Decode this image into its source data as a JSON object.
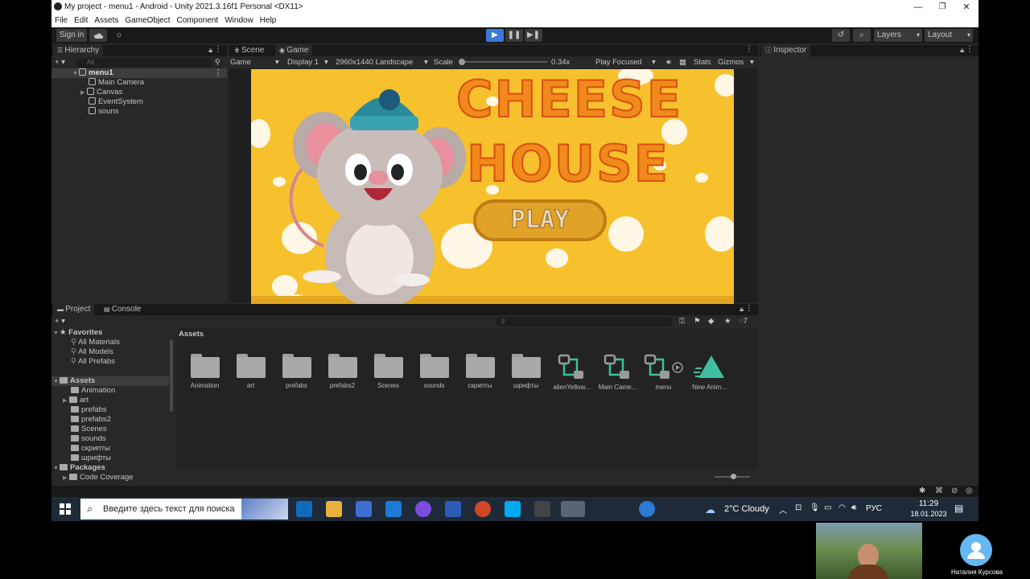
{
  "window": {
    "title": "My project - menu1 - Android - Unity 2021.3.16f1 Personal <DX11>",
    "minimize": "—",
    "maximize": "❐",
    "close": "✕"
  },
  "menu": [
    "File",
    "Edit",
    "Assets",
    "GameObject",
    "Component",
    "Window",
    "Help"
  ],
  "toolbar": {
    "sign_in": "Sign in",
    "layers": "Layers",
    "layout": "Layout"
  },
  "hierarchy": {
    "tab": "Hierarchy",
    "search_placeholder": "All",
    "scene": "menu1",
    "items": [
      "Main Camera",
      "Canvas",
      "EventSystem",
      "souns"
    ]
  },
  "scene_tabs": {
    "scene": "Scene",
    "game": "Game"
  },
  "game_toolbar": {
    "mode": "Game",
    "display": "Display 1",
    "resolution": "2960x1440 Landscape",
    "scale_label": "Scale",
    "scale_value": "0.34x",
    "play_focused": "Play Focused",
    "stats": "Stats",
    "gizmos": "Gizmos",
    "scale_fraction": 0.0
  },
  "game": {
    "title_line1": "CHEESE",
    "title_line2": "HOUSE",
    "play_button": "PLAY"
  },
  "inspector": {
    "tab": "Inspector"
  },
  "project": {
    "tab_project": "Project",
    "tab_console": "Console",
    "favorites_label": "Favorites",
    "favorites": [
      "All Materials",
      "All Models",
      "All Prefabs"
    ],
    "assets_label": "Assets",
    "asset_folders_tree": [
      "Animation",
      "art",
      "prefabs",
      "prefabs2",
      "Scenes",
      "sounds",
      "скрипты",
      "шрифты"
    ],
    "packages_label": "Packages",
    "packages": [
      "Code Coverage"
    ],
    "breadcrumb": "Assets",
    "hidden_count": "7",
    "grid_items": [
      {
        "label": "Animation",
        "kind": "folder"
      },
      {
        "label": "art",
        "kind": "folder"
      },
      {
        "label": "prefabs",
        "kind": "folder"
      },
      {
        "label": "prefabs2",
        "kind": "folder"
      },
      {
        "label": "Scenes",
        "kind": "folder"
      },
      {
        "label": "sounds",
        "kind": "folder"
      },
      {
        "label": "скрипты",
        "kind": "folder"
      },
      {
        "label": "шрифты",
        "kind": "folder"
      },
      {
        "label": "alienYellow...",
        "kind": "animator"
      },
      {
        "label": "Main Came...",
        "kind": "animator"
      },
      {
        "label": "menu",
        "kind": "animator-play"
      },
      {
        "label": "New Anim...",
        "kind": "animation"
      }
    ]
  },
  "taskbar": {
    "search_placeholder": "Введите здесь текст для поиска",
    "weather": "2°C  Cloudy",
    "lang": "РУС",
    "time": "11:29",
    "date": "18.01.2023"
  },
  "video": {
    "participant_name": "Наталия Курсова"
  },
  "colors": {
    "unity_bg": "#282828",
    "unity_dark": "#191919",
    "game_yellow": "#f6c12d",
    "title_orange": "#f08a1b",
    "play_blue": "#3a79d8"
  }
}
